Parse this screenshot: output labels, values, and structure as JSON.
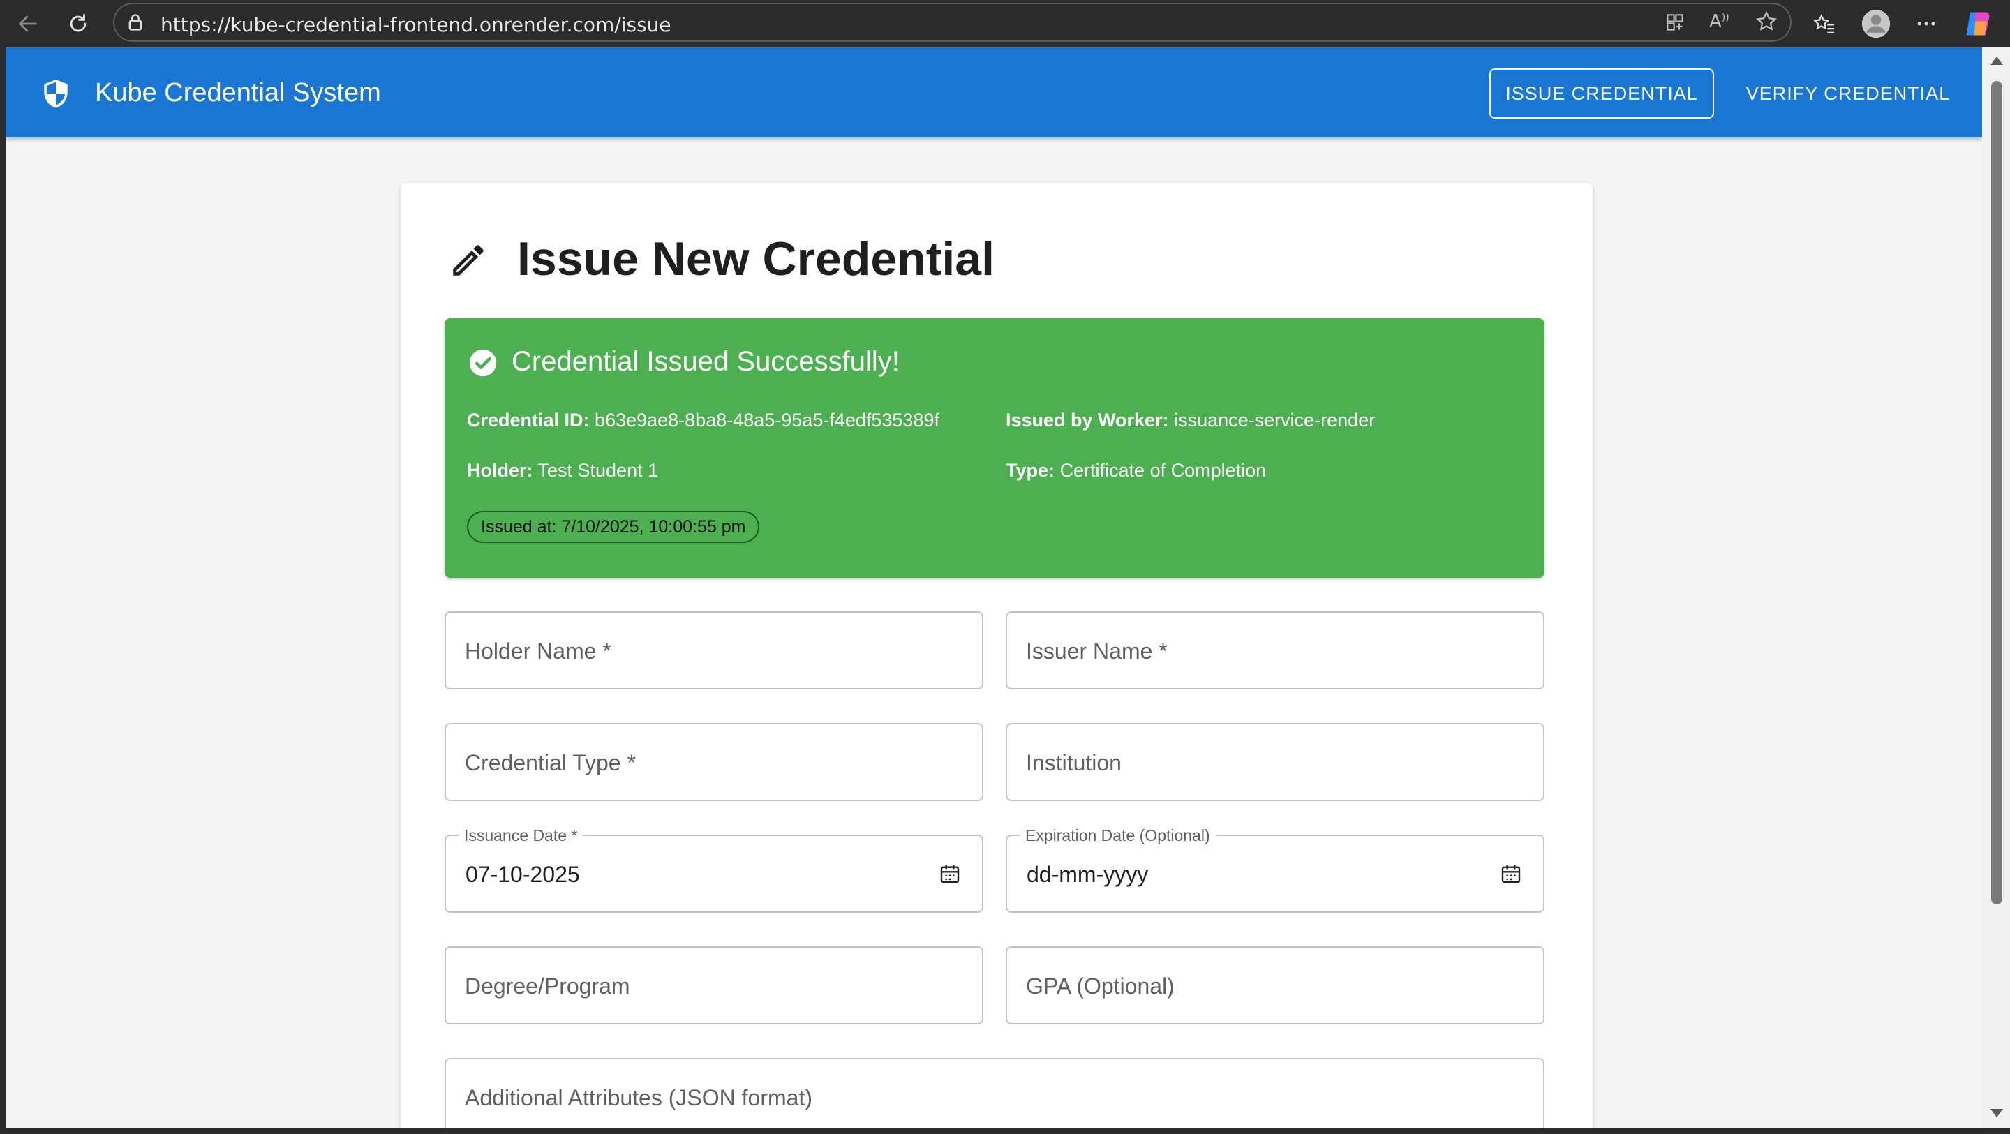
{
  "browser": {
    "url": "https://kube-credential-frontend.onrender.com/issue"
  },
  "appbar": {
    "title": "Kube Credential System",
    "nav": {
      "issue": "ISSUE CREDENTIAL",
      "verify": "VERIFY CREDENTIAL"
    }
  },
  "page": {
    "title": "Issue New Credential"
  },
  "success": {
    "title": "Credential Issued Successfully!",
    "credential_id_label": "Credential ID:",
    "credential_id": "b63e9ae8-8ba8-48a5-95a5-f4edf535389f",
    "worker_label": "Issued by Worker:",
    "worker": "issuance-service-render",
    "holder_label": "Holder:",
    "holder": "Test Student 1",
    "type_label": "Type:",
    "type": "Certificate of Completion",
    "issued_at": "Issued at: 7/10/2025, 10:00:55 pm"
  },
  "form": {
    "holder_name": "Holder Name *",
    "issuer_name": "Issuer Name *",
    "credential_type": "Credential Type *",
    "institution": "Institution",
    "issuance_date_label": "Issuance Date *",
    "issuance_date_value": "07-10-2025",
    "expiration_date_label": "Expiration Date (Optional)",
    "expiration_date_value": "dd-mm-yyyy",
    "degree_program": "Degree/Program",
    "gpa": "GPA (Optional)",
    "additional_attributes": "Additional Attributes (JSON format)"
  },
  "colors": {
    "appbar": "#1976d2",
    "success": "#4caf50"
  }
}
